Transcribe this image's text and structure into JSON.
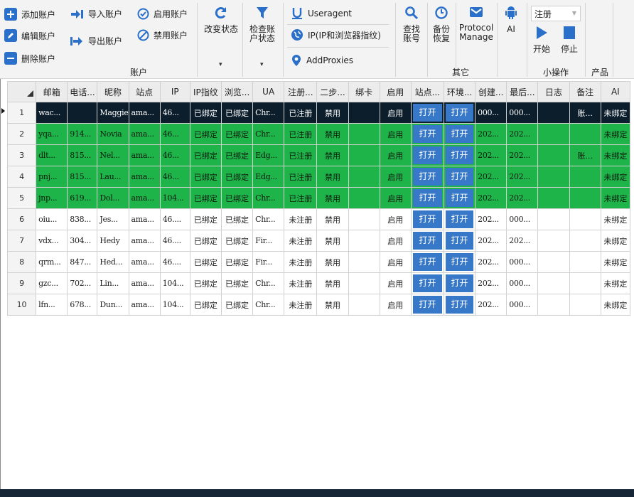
{
  "ribbon": {
    "account": {
      "add": "添加账户",
      "edit": "编辑账户",
      "delete": "删除账户",
      "import": "导入账户",
      "export": "导出账户",
      "enable": "启用账户",
      "disable": "禁用账户",
      "group_label": "账户"
    },
    "change_status": "改变状态",
    "check_status": "检查账\n户状态",
    "useragent": "Useragent",
    "ip_fingerprint": "IP(IP和浏览器指纹)",
    "add_proxies": "AddProxies",
    "search_account": "查找\n账号",
    "backup_restore": "备份\n恢复",
    "protocol_manage": "Protocol\nManage",
    "ai": "AI",
    "other_label": "其它",
    "combo_value": "注册",
    "start": "开始",
    "stop": "停止",
    "small_ops_label": "小操作",
    "product_label": "产品"
  },
  "colors": {
    "selected_row": "#0c1e2c",
    "registered_row": "#1fb44a",
    "open_button": "#3878c9",
    "accent_icon": "#2a6fc9"
  },
  "grid": {
    "columns": [
      "",
      "邮箱",
      "电话...",
      "昵称",
      "站点",
      "IP",
      "IP指纹",
      "浏览...",
      "UA",
      "注册...",
      "二步...",
      "绑卡",
      "启用",
      "站点...",
      "环境...",
      "创建...",
      "最后...",
      "日志",
      "备注",
      "AI"
    ],
    "rows": [
      {
        "style": "black",
        "num": "1",
        "email": "wac...",
        "phone": "",
        "nick": "Maggie",
        "site": "ama...",
        "ip": "46...",
        "ipfp": "已绑定",
        "browser": "已绑定",
        "ua": "Chr...",
        "reg": "已注册",
        "two": "禁用",
        "card": "",
        "enabled": "启用",
        "site_open": "打开",
        "env_open": "打开",
        "created": "000...",
        "last": "000...",
        "log": "",
        "note": "账...",
        "ai": "未绑定"
      },
      {
        "style": "green",
        "num": "2",
        "email": "yqa...",
        "phone": "914...",
        "nick": "Novia",
        "site": "ama...",
        "ip": "46...",
        "ipfp": "已绑定",
        "browser": "已绑定",
        "ua": "Chr...",
        "reg": "已注册",
        "two": "禁用",
        "card": "",
        "enabled": "启用",
        "site_open": "打开",
        "env_open": "打开",
        "created": "202...",
        "last": "202...",
        "log": "",
        "note": "",
        "ai": "未绑定"
      },
      {
        "style": "green",
        "num": "3",
        "email": "dlt...",
        "phone": "815...",
        "nick": "Nel...",
        "site": "ama...",
        "ip": "46...",
        "ipfp": "已绑定",
        "browser": "已绑定",
        "ua": "Edg...",
        "reg": "已注册",
        "two": "禁用",
        "card": "",
        "enabled": "启用",
        "site_open": "打开",
        "env_open": "打开",
        "created": "202...",
        "last": "202...",
        "log": "",
        "note": "账...",
        "ai": "未绑定"
      },
      {
        "style": "green",
        "num": "4",
        "email": "pnj...",
        "phone": "815...",
        "nick": "Lau...",
        "site": "ama...",
        "ip": "46...",
        "ipfp": "已绑定",
        "browser": "已绑定",
        "ua": "Edg...",
        "reg": "已注册",
        "two": "禁用",
        "card": "",
        "enabled": "启用",
        "site_open": "打开",
        "env_open": "打开",
        "created": "202...",
        "last": "202...",
        "log": "",
        "note": "",
        "ai": "未绑定"
      },
      {
        "style": "green",
        "num": "5",
        "email": "jnp...",
        "phone": "619...",
        "nick": "Dol...",
        "site": "ama...",
        "ip": "104...",
        "ipfp": "已绑定",
        "browser": "已绑定",
        "ua": "Chr...",
        "reg": "已注册",
        "two": "禁用",
        "card": "",
        "enabled": "启用",
        "site_open": "打开",
        "env_open": "打开",
        "created": "202...",
        "last": "202...",
        "log": "",
        "note": "",
        "ai": "未绑定"
      },
      {
        "style": "white",
        "num": "6",
        "email": "oiu...",
        "phone": "838...",
        "nick": "Jes...",
        "site": "ama...",
        "ip": "46....",
        "ipfp": "已绑定",
        "browser": "已绑定",
        "ua": "Chr...",
        "reg": "未注册",
        "two": "禁用",
        "card": "",
        "enabled": "启用",
        "site_open": "打开",
        "env_open": "打开",
        "created": "202...",
        "last": "000...",
        "log": "",
        "note": "",
        "ai": "未绑定"
      },
      {
        "style": "white",
        "num": "7",
        "email": "vdx...",
        "phone": "304...",
        "nick": "Hedy",
        "site": "ama...",
        "ip": "46....",
        "ipfp": "已绑定",
        "browser": "已绑定",
        "ua": "Fir...",
        "reg": "未注册",
        "two": "禁用",
        "card": "",
        "enabled": "启用",
        "site_open": "打开",
        "env_open": "打开",
        "created": "202...",
        "last": "202...",
        "log": "",
        "note": "",
        "ai": "未绑定"
      },
      {
        "style": "white",
        "num": "8",
        "email": "qrm...",
        "phone": "847...",
        "nick": "Hed...",
        "site": "ama...",
        "ip": "46....",
        "ipfp": "已绑定",
        "browser": "已绑定",
        "ua": "Fir...",
        "reg": "未注册",
        "two": "禁用",
        "card": "",
        "enabled": "启用",
        "site_open": "打开",
        "env_open": "打开",
        "created": "202...",
        "last": "000...",
        "log": "",
        "note": "",
        "ai": "未绑定"
      },
      {
        "style": "white",
        "num": "9",
        "email": "gzc...",
        "phone": "702...",
        "nick": "Lin...",
        "site": "ama...",
        "ip": "104...",
        "ipfp": "已绑定",
        "browser": "已绑定",
        "ua": "Chr...",
        "reg": "未注册",
        "two": "禁用",
        "card": "",
        "enabled": "启用",
        "site_open": "打开",
        "env_open": "打开",
        "created": "202...",
        "last": "000...",
        "log": "",
        "note": "",
        "ai": "未绑定"
      },
      {
        "style": "white",
        "num": "10",
        "email": "lfn...",
        "phone": "678...",
        "nick": "Dun...",
        "site": "ama...",
        "ip": "104...",
        "ipfp": "已绑定",
        "browser": "已绑定",
        "ua": "Chr...",
        "reg": "未注册",
        "two": "禁用",
        "card": "",
        "enabled": "启用",
        "site_open": "打开",
        "env_open": "打开",
        "created": "202...",
        "last": "000...",
        "log": "",
        "note": "",
        "ai": "未绑定"
      }
    ]
  }
}
